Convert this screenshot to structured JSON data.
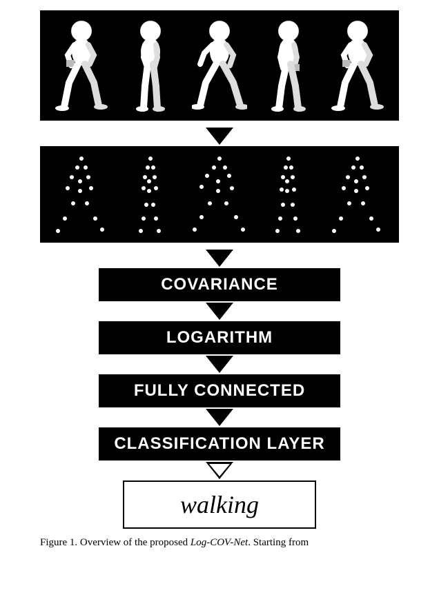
{
  "diagram": {
    "layers": [
      {
        "name": "covariance",
        "label": "COVARIANCE"
      },
      {
        "name": "logarithm",
        "label": "LOGARITHM"
      },
      {
        "name": "fully-connected",
        "label": "FULLY CONNECTED"
      },
      {
        "name": "classification",
        "label": "CLASSIFICATION LAYER"
      }
    ],
    "output": "walking",
    "input_description": "sequence of walking human figures",
    "feature_description": "body joint positions as points"
  },
  "caption": {
    "prefix": "Figure 1. Overview of the proposed ",
    "model_name": "Log-COV-Net",
    "suffix": ". Starting from"
  },
  "figures_count": 5,
  "joints_per_figure": 15
}
